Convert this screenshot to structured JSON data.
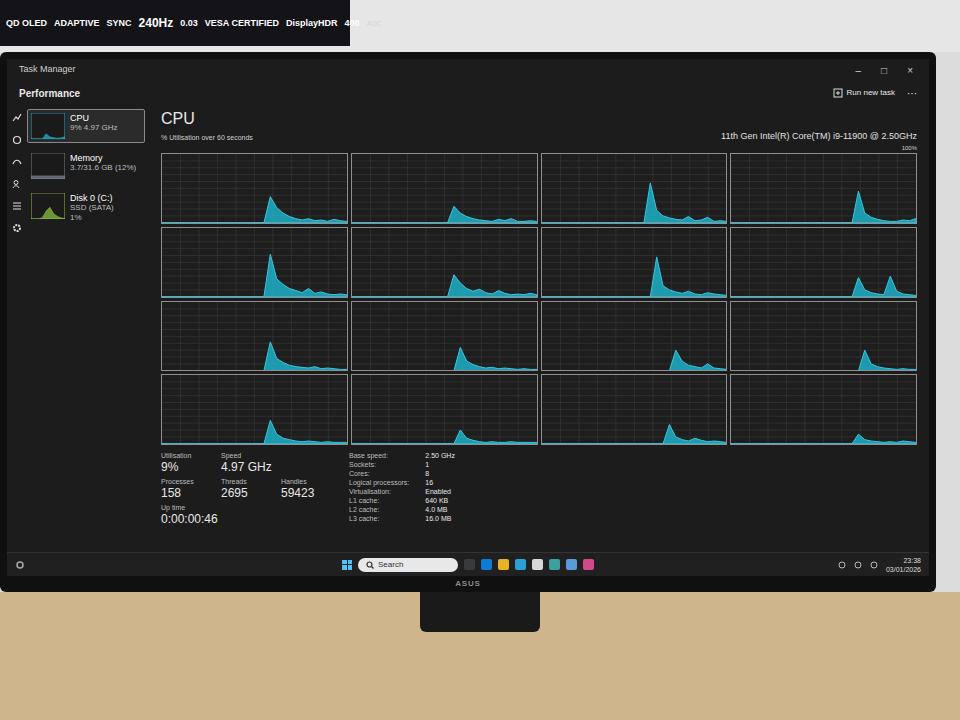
{
  "sticker": {
    "items": [
      "QD OLED",
      "ADAPTIVE",
      "SYNC",
      "240Hz",
      "0.03",
      "VESA CERTIFIED",
      "DisplayHDR",
      "400",
      "AOC"
    ]
  },
  "window": {
    "title": "Task Manager",
    "controls": [
      "–",
      "□",
      "×"
    ]
  },
  "header": {
    "title": "Performance",
    "run_task": "Run new task",
    "more": "···"
  },
  "sidebar": {
    "items": [
      {
        "lines": [
          "CPU",
          "9% 4.97 GHz"
        ],
        "selected": true,
        "color": "#1fb0c8",
        "values": [
          0,
          0,
          0,
          0,
          20,
          8,
          5,
          3,
          4,
          9
        ]
      },
      {
        "lines": [
          "Memory",
          "3.7/31.6 GB (12%)"
        ],
        "selected": false,
        "color": "#7a7f8c",
        "values": [
          12,
          12,
          12,
          12,
          12,
          12,
          12,
          12,
          12,
          12
        ]
      },
      {
        "lines": [
          "Disk 0 (C:)",
          "SSD (SATA)",
          "1%"
        ],
        "selected": false,
        "color": "#8bbf3c",
        "values": [
          0,
          0,
          0,
          5,
          30,
          45,
          20,
          10,
          4,
          2
        ]
      }
    ]
  },
  "cpu": {
    "title": "CPU",
    "axis_label": "% Utilisation over 60 seconds",
    "model": "11th Gen Intel(R) Core(TM) i9-11900 @ 2.50GHz",
    "max_label": "100%",
    "series": [
      [
        0,
        0,
        0,
        0,
        0,
        0,
        0,
        0,
        0,
        0,
        0,
        0,
        0,
        0,
        0,
        0,
        0,
        38,
        22,
        14,
        9,
        6,
        4,
        6,
        3,
        4,
        2,
        5,
        3,
        2
      ],
      [
        0,
        0,
        0,
        0,
        0,
        0,
        0,
        0,
        0,
        0,
        0,
        0,
        0,
        0,
        0,
        0,
        24,
        14,
        9,
        6,
        4,
        3,
        2,
        5,
        3,
        6,
        2,
        2,
        3,
        2
      ],
      [
        0,
        0,
        0,
        0,
        0,
        0,
        0,
        0,
        0,
        0,
        0,
        0,
        0,
        0,
        0,
        0,
        0,
        58,
        18,
        10,
        7,
        5,
        4,
        9,
        3,
        4,
        8,
        2,
        3,
        2
      ],
      [
        0,
        0,
        0,
        0,
        0,
        0,
        0,
        0,
        0,
        0,
        0,
        0,
        0,
        0,
        0,
        0,
        0,
        0,
        0,
        0,
        46,
        14,
        8,
        5,
        3,
        2,
        2,
        4,
        3,
        6
      ],
      [
        0,
        0,
        0,
        0,
        0,
        0,
        0,
        0,
        0,
        0,
        0,
        0,
        0,
        0,
        0,
        0,
        0,
        62,
        26,
        18,
        12,
        9,
        6,
        12,
        5,
        7,
        4,
        3,
        4,
        3
      ],
      [
        0,
        0,
        0,
        0,
        0,
        0,
        0,
        0,
        0,
        0,
        0,
        0,
        0,
        0,
        0,
        0,
        32,
        20,
        12,
        8,
        11,
        6,
        4,
        9,
        5,
        3,
        4,
        3,
        5,
        3
      ],
      [
        0,
        0,
        0,
        0,
        0,
        0,
        0,
        0,
        0,
        0,
        0,
        0,
        0,
        0,
        0,
        0,
        0,
        0,
        58,
        16,
        10,
        7,
        5,
        8,
        4,
        3,
        6,
        4,
        3,
        2
      ],
      [
        0,
        0,
        0,
        0,
        0,
        0,
        0,
        0,
        0,
        0,
        0,
        0,
        0,
        0,
        0,
        0,
        0,
        0,
        0,
        0,
        28,
        10,
        6,
        4,
        3,
        30,
        8,
        4,
        3,
        2
      ],
      [
        0,
        0,
        0,
        0,
        0,
        0,
        0,
        0,
        0,
        0,
        0,
        0,
        0,
        0,
        0,
        0,
        0,
        42,
        18,
        12,
        8,
        6,
        5,
        4,
        6,
        3,
        4,
        3,
        2,
        2
      ],
      [
        0,
        0,
        0,
        0,
        0,
        0,
        0,
        0,
        0,
        0,
        0,
        0,
        0,
        0,
        0,
        0,
        0,
        34,
        14,
        9,
        6,
        4,
        5,
        3,
        4,
        3,
        2,
        3,
        2,
        2
      ],
      [
        0,
        0,
        0,
        0,
        0,
        0,
        0,
        0,
        0,
        0,
        0,
        0,
        0,
        0,
        0,
        0,
        0,
        0,
        0,
        0,
        0,
        30,
        14,
        8,
        6,
        4,
        10,
        4,
        3,
        2
      ],
      [
        0,
        0,
        0,
        0,
        0,
        0,
        0,
        0,
        0,
        0,
        0,
        0,
        0,
        0,
        0,
        0,
        0,
        0,
        0,
        0,
        0,
        30,
        10,
        6,
        4,
        3,
        2,
        3,
        2,
        2
      ],
      [
        0,
        0,
        0,
        0,
        0,
        0,
        0,
        0,
        0,
        0,
        0,
        0,
        0,
        0,
        0,
        0,
        0,
        34,
        14,
        8,
        6,
        4,
        3,
        4,
        3,
        2,
        3,
        2,
        2,
        2
      ],
      [
        0,
        0,
        0,
        0,
        0,
        0,
        0,
        0,
        0,
        0,
        0,
        0,
        0,
        0,
        0,
        0,
        0,
        20,
        8,
        5,
        3,
        2,
        3,
        2,
        2,
        3,
        2,
        2,
        2,
        2
      ],
      [
        0,
        0,
        0,
        0,
        0,
        0,
        0,
        0,
        0,
        0,
        0,
        0,
        0,
        0,
        0,
        0,
        0,
        0,
        0,
        0,
        28,
        10,
        6,
        4,
        8,
        5,
        3,
        4,
        3,
        2
      ],
      [
        0,
        0,
        0,
        0,
        0,
        0,
        0,
        0,
        0,
        0,
        0,
        0,
        0,
        0,
        0,
        0,
        0,
        0,
        0,
        0,
        14,
        6,
        4,
        3,
        2,
        3,
        2,
        4,
        3,
        2
      ]
    ]
  },
  "stat_rows": [
    [
      {
        "label": "Utilisation",
        "value": "9%"
      },
      {
        "label": "Speed",
        "value": "4.97 GHz"
      }
    ],
    [
      {
        "label": "Processes",
        "value": "158"
      },
      {
        "label": "Threads",
        "value": "2695"
      },
      {
        "label": "Handles",
        "value": "59423"
      }
    ],
    [
      {
        "label": "Up time",
        "value": "0:00:00:46"
      }
    ]
  ],
  "specs": [
    {
      "label": "Base speed:",
      "value": "2.50 GHz"
    },
    {
      "label": "Sockets:",
      "value": "1"
    },
    {
      "label": "Cores:",
      "value": "8"
    },
    {
      "label": "Logical processors:",
      "value": "16"
    },
    {
      "label": "Virtualisation:",
      "value": "Enabled"
    },
    {
      "label": "L1 cache:",
      "value": "640 KB"
    },
    {
      "label": "L2 cache:",
      "value": "4.0 MB"
    },
    {
      "label": "L3 cache:",
      "value": "16.0 MB"
    }
  ],
  "taskbar": {
    "search": "Search",
    "time": "23:38",
    "date": "03/01/2026"
  },
  "monitor": {
    "brand": "ASUS"
  }
}
